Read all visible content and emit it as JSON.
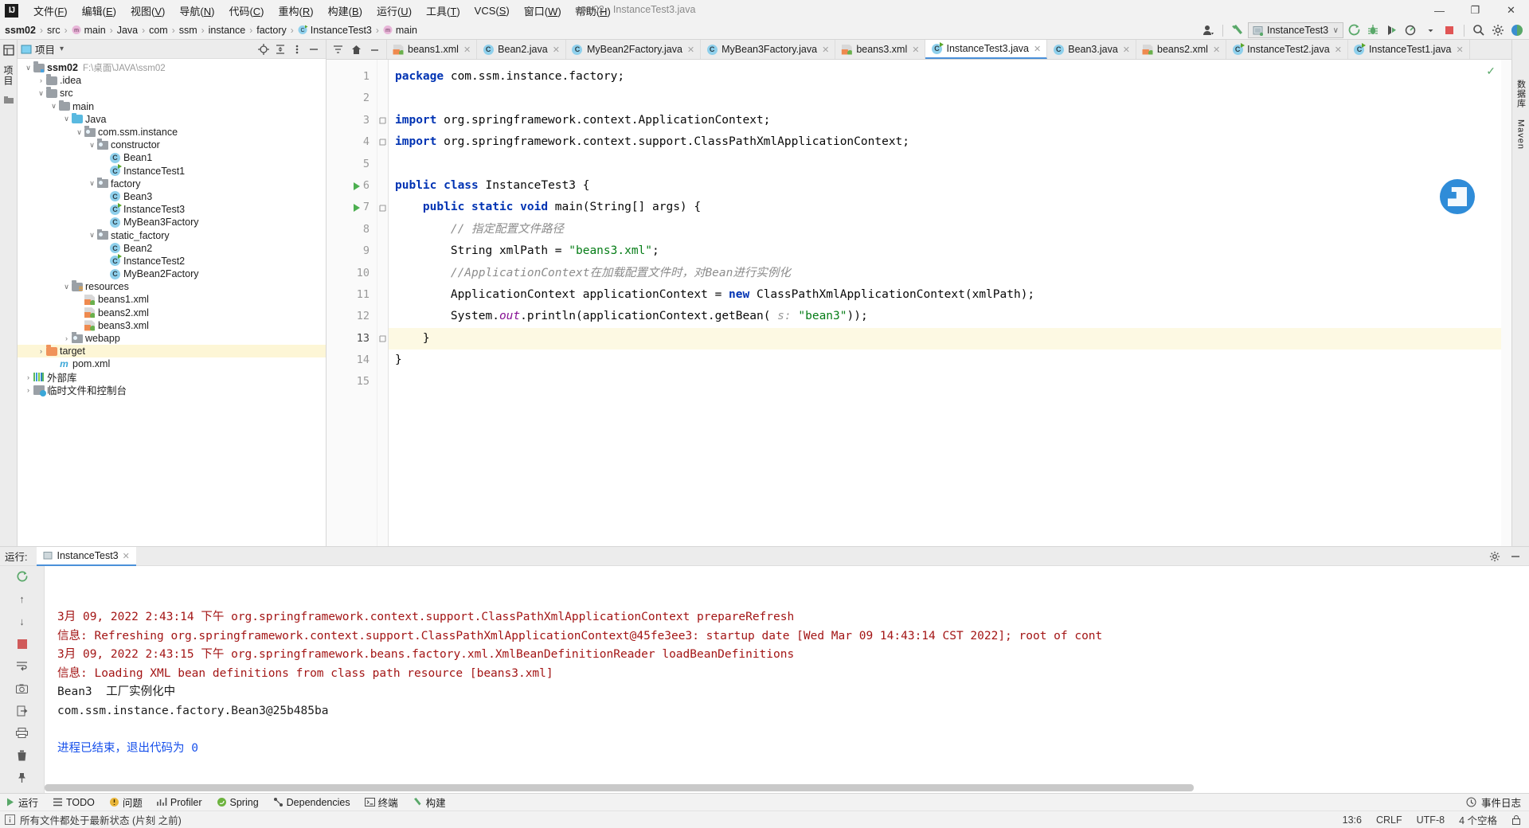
{
  "window": {
    "title": "ssm02 - InstanceTest3.java",
    "logo": "IJ",
    "controls": {
      "minimize": "—",
      "maximize": "❐",
      "close": "✕"
    }
  },
  "menubar": {
    "items": [
      {
        "label": "文件(F)",
        "name": "menu-file"
      },
      {
        "label": "编辑(E)",
        "name": "menu-edit"
      },
      {
        "label": "视图(V)",
        "name": "menu-view"
      },
      {
        "label": "导航(N)",
        "name": "menu-navigate"
      },
      {
        "label": "代码(C)",
        "name": "menu-code"
      },
      {
        "label": "重构(R)",
        "name": "menu-refactor"
      },
      {
        "label": "构建(B)",
        "name": "menu-build"
      },
      {
        "label": "运行(U)",
        "name": "menu-run"
      },
      {
        "label": "工具(T)",
        "name": "menu-tools"
      },
      {
        "label": "VCS(S)",
        "name": "menu-vcs"
      },
      {
        "label": "窗口(W)",
        "name": "menu-window"
      },
      {
        "label": "帮助(H)",
        "name": "menu-help"
      }
    ]
  },
  "breadcrumb": {
    "items": [
      "ssm02",
      "src",
      "main",
      "Java",
      "com",
      "ssm",
      "instance",
      "factory",
      "InstanceTest3",
      "main"
    ],
    "separator": "›"
  },
  "toolbar": {
    "run_config": "InstanceTest3",
    "run_config_chevron": "∨",
    "buttons": [
      {
        "name": "user-account-icon",
        "label": "account"
      },
      {
        "name": "build-hammer-icon",
        "label": "build"
      },
      {
        "name": "run-icon",
        "label": "run"
      },
      {
        "name": "debug-icon",
        "label": "debug"
      },
      {
        "name": "run-with-coverage-icon",
        "label": "run with coverage"
      },
      {
        "name": "profiler-icon",
        "label": "profile"
      },
      {
        "name": "stop-icon",
        "label": "stop"
      },
      {
        "name": "search-everywhere-icon",
        "label": "search"
      },
      {
        "name": "settings-gear-icon",
        "label": "settings"
      },
      {
        "name": "updates-icon",
        "label": "updates"
      }
    ]
  },
  "left_strip": {
    "project_label": "项目",
    "structure_icon": "structure-icon"
  },
  "project_panel": {
    "title": "项目",
    "chevron": "▾",
    "header_icons": [
      "locate-icon",
      "collapse-all-icon",
      "more-options-icon",
      "hide-icon"
    ],
    "tree": [
      {
        "indent": 0,
        "arrow": "∨",
        "icon": "folder-module",
        "label": "ssm02",
        "bold": true,
        "path": "F:\\桌面\\JAVA\\ssm02",
        "selected": false
      },
      {
        "indent": 1,
        "arrow": "›",
        "icon": "folder",
        "label": ".idea",
        "selected": false
      },
      {
        "indent": 1,
        "arrow": "∨",
        "icon": "folder",
        "label": "src",
        "selected": false
      },
      {
        "indent": 2,
        "arrow": "∨",
        "icon": "folder",
        "label": "main",
        "selected": false
      },
      {
        "indent": 3,
        "arrow": "∨",
        "icon": "folder-source",
        "label": "Java",
        "selected": false
      },
      {
        "indent": 4,
        "arrow": "∨",
        "icon": "package",
        "label": "com.ssm.instance",
        "selected": false
      },
      {
        "indent": 5,
        "arrow": "∨",
        "icon": "package",
        "label": "constructor",
        "selected": false
      },
      {
        "indent": 6,
        "arrow": "",
        "icon": "class",
        "label": "Bean1",
        "selected": false
      },
      {
        "indent": 6,
        "arrow": "",
        "icon": "class-runnable",
        "label": "InstanceTest1",
        "selected": false
      },
      {
        "indent": 5,
        "arrow": "∨",
        "icon": "package",
        "label": "factory",
        "selected": false
      },
      {
        "indent": 6,
        "arrow": "",
        "icon": "class",
        "label": "Bean3",
        "selected": false
      },
      {
        "indent": 6,
        "arrow": "",
        "icon": "class-runnable",
        "label": "InstanceTest3",
        "selected": false
      },
      {
        "indent": 6,
        "arrow": "",
        "icon": "class",
        "label": "MyBean3Factory",
        "selected": false
      },
      {
        "indent": 5,
        "arrow": "∨",
        "icon": "package",
        "label": "static_factory",
        "selected": false
      },
      {
        "indent": 6,
        "arrow": "",
        "icon": "class",
        "label": "Bean2",
        "selected": false
      },
      {
        "indent": 6,
        "arrow": "",
        "icon": "class-runnable",
        "label": "InstanceTest2",
        "selected": false
      },
      {
        "indent": 6,
        "arrow": "",
        "icon": "class",
        "label": "MyBean2Factory",
        "selected": false
      },
      {
        "indent": 3,
        "arrow": "∨",
        "icon": "folder-resource",
        "label": "resources",
        "selected": false
      },
      {
        "indent": 4,
        "arrow": "",
        "icon": "xml",
        "label": "beans1.xml",
        "selected": false
      },
      {
        "indent": 4,
        "arrow": "",
        "icon": "xml",
        "label": "beans2.xml",
        "selected": false
      },
      {
        "indent": 4,
        "arrow": "",
        "icon": "xml",
        "label": "beans3.xml",
        "selected": false
      },
      {
        "indent": 3,
        "arrow": "›",
        "icon": "package",
        "label": "webapp",
        "selected": false
      },
      {
        "indent": 1,
        "arrow": "›",
        "icon": "folder-target",
        "label": "target",
        "selected": true
      },
      {
        "indent": 2,
        "arrow": "",
        "icon": "maven",
        "label": "pom.xml",
        "selected": false
      },
      {
        "indent": 0,
        "arrow": "›",
        "icon": "library",
        "label": "外部库",
        "selected": false
      },
      {
        "indent": 0,
        "arrow": "›",
        "icon": "scratch",
        "label": "临时文件和控制台",
        "selected": false
      }
    ]
  },
  "editor": {
    "lead_icons": [
      "sort-icon",
      "home-icon",
      "minimize-icon"
    ],
    "tabs": [
      {
        "label": "beans1.xml",
        "icon": "xml",
        "active": false
      },
      {
        "label": "Bean2.java",
        "icon": "class",
        "active": false
      },
      {
        "label": "MyBean2Factory.java",
        "icon": "class",
        "active": false
      },
      {
        "label": "MyBean3Factory.java",
        "icon": "class",
        "active": false
      },
      {
        "label": "beans3.xml",
        "icon": "xml",
        "active": false
      },
      {
        "label": "InstanceTest3.java",
        "icon": "class-runnable",
        "active": true
      },
      {
        "label": "Bean3.java",
        "icon": "class",
        "active": false
      },
      {
        "label": "beans2.xml",
        "icon": "xml",
        "active": false
      },
      {
        "label": "InstanceTest2.java",
        "icon": "class-runnable",
        "active": false
      },
      {
        "label": "InstanceTest1.java",
        "icon": "class-runnable",
        "active": false
      }
    ],
    "tab_close": "✕",
    "line_numbers": [
      "1",
      "2",
      "3",
      "4",
      "5",
      "6",
      "7",
      "8",
      "9",
      "10",
      "11",
      "12",
      "13",
      "14",
      "15"
    ],
    "current_line": 13,
    "inspection_status": "✓",
    "code_lines": [
      {
        "n": 1,
        "tokens": [
          {
            "t": "kw",
            "v": "package "
          },
          {
            "t": "pln",
            "v": "com.ssm.instance.factory;"
          }
        ]
      },
      {
        "n": 2,
        "tokens": []
      },
      {
        "n": 3,
        "fold": true,
        "tokens": [
          {
            "t": "kw",
            "v": "import "
          },
          {
            "t": "pln",
            "v": "org.springframework.context.ApplicationContext;"
          }
        ]
      },
      {
        "n": 4,
        "fold": true,
        "tokens": [
          {
            "t": "kw",
            "v": "import "
          },
          {
            "t": "pln",
            "v": "org.springframework.context.support.ClassPathXmlApplicationContext;"
          }
        ]
      },
      {
        "n": 5,
        "tokens": []
      },
      {
        "n": 6,
        "run": true,
        "tokens": [
          {
            "t": "kw",
            "v": "public class "
          },
          {
            "t": "pln",
            "v": "InstanceTest3 {"
          }
        ]
      },
      {
        "n": 7,
        "run": true,
        "fold": true,
        "indent": 1,
        "tokens": [
          {
            "t": "kw",
            "v": "public static void "
          },
          {
            "t": "pln",
            "v": "main(String[] args) {"
          }
        ]
      },
      {
        "n": 8,
        "indent": 2,
        "tokens": [
          {
            "t": "cm",
            "v": "// 指定配置文件路径"
          }
        ]
      },
      {
        "n": 9,
        "indent": 2,
        "tokens": [
          {
            "t": "pln",
            "v": "String xmlPath = "
          },
          {
            "t": "str",
            "v": "\"beans3.xml\""
          },
          {
            "t": "pln",
            "v": ";"
          }
        ]
      },
      {
        "n": 10,
        "indent": 2,
        "tokens": [
          {
            "t": "cm",
            "v": "//ApplicationContext在加载配置文件时，对Bean进行实例化"
          }
        ]
      },
      {
        "n": 11,
        "indent": 2,
        "tokens": [
          {
            "t": "pln",
            "v": "ApplicationContext applicationContext = "
          },
          {
            "t": "kw",
            "v": "new "
          },
          {
            "t": "pln",
            "v": "ClassPathXmlApplicationContext(xmlPath);"
          }
        ]
      },
      {
        "n": 12,
        "indent": 2,
        "tokens": [
          {
            "t": "pln",
            "v": "System."
          },
          {
            "t": "fld-s",
            "v": "out"
          },
          {
            "t": "pln",
            "v": ".println(applicationContext.getBean( "
          },
          {
            "t": "hint",
            "v": "s: "
          },
          {
            "t": "str",
            "v": "\"bean3\""
          },
          {
            "t": "pln",
            "v": "));"
          }
        ]
      },
      {
        "n": 13,
        "indent": 1,
        "fold": true,
        "hl": true,
        "tokens": [
          {
            "t": "pln",
            "v": "}"
          }
        ]
      },
      {
        "n": 14,
        "tokens": [
          {
            "t": "pln",
            "v": "}"
          }
        ]
      },
      {
        "n": 15,
        "tokens": []
      }
    ]
  },
  "right_strip": {
    "items": [
      "数据库",
      "Maven"
    ]
  },
  "run_panel": {
    "label": "运行:",
    "tab": "InstanceTest3",
    "tab_close": "✕",
    "gutter_icons": [
      "rerun-icon",
      "scroll-up-icon",
      "scroll-down-icon",
      "soft-wrap-icon",
      "scroll-to-end-icon",
      "stop-icon",
      "camera-icon",
      "export-icon",
      "print-icon",
      "trash-icon",
      "pin-icon"
    ],
    "header_icons": [
      "settings-gear-icon",
      "hide-icon"
    ],
    "console_lines": [
      {
        "color": "red",
        "text": "3月 09, 2022 2:43:14 下午 org.springframework.context.support.ClassPathXmlApplicationContext prepareRefresh"
      },
      {
        "color": "red",
        "text": "信息: Refreshing org.springframework.context.support.ClassPathXmlApplicationContext@45fe3ee3: startup date [Wed Mar 09 14:43:14 CST 2022]; root of cont"
      },
      {
        "color": "red",
        "text": "3月 09, 2022 2:43:15 下午 org.springframework.beans.factory.xml.XmlBeanDefinitionReader loadBeanDefinitions"
      },
      {
        "color": "red",
        "text": "信息: Loading XML bean definitions from class path resource [beans3.xml]"
      },
      {
        "color": "black",
        "text": "Bean3  工厂实例化中"
      },
      {
        "color": "black",
        "text": "com.ssm.instance.factory.Bean3@25b485ba"
      },
      {
        "color": "black",
        "text": ""
      },
      {
        "color": "blue",
        "text": "进程已结束，退出代码为 0"
      }
    ]
  },
  "bottom_bar": {
    "items": [
      {
        "label": "运行",
        "icon": "run-icon",
        "name": "bottom-tab-run"
      },
      {
        "label": "TODO",
        "icon": "todo-icon",
        "name": "bottom-tab-todo"
      },
      {
        "label": "问题",
        "icon": "problems-icon",
        "name": "bottom-tab-problems"
      },
      {
        "label": "Profiler",
        "icon": "profiler-icon",
        "name": "bottom-tab-profiler"
      },
      {
        "label": "Spring",
        "icon": "spring-icon",
        "name": "bottom-tab-spring"
      },
      {
        "label": "Dependencies",
        "icon": "dependencies-icon",
        "name": "bottom-tab-dependencies"
      },
      {
        "label": "终端",
        "icon": "terminal-icon",
        "name": "bottom-tab-terminal"
      },
      {
        "label": "构建",
        "icon": "build-icon",
        "name": "bottom-tab-build"
      }
    ],
    "event_log": "事件日志"
  },
  "status_bar": {
    "message": "所有文件都处于最新状态 (片刻 之前)",
    "caret": "13:6",
    "line_sep": "CRLF",
    "encoding": "UTF-8",
    "indent": "4 个空格",
    "lock_icon": "lock-icon"
  }
}
